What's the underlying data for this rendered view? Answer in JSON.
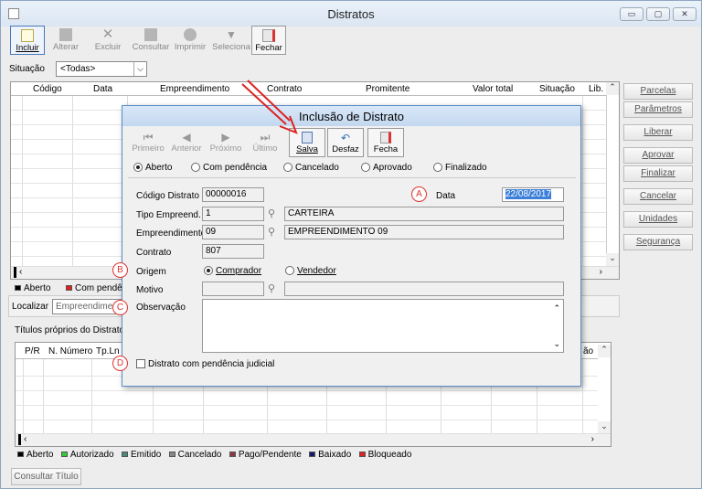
{
  "window": {
    "title": "Distratos",
    "min": "▭",
    "max": "▢",
    "close": "✕"
  },
  "toolbar": {
    "incluir": "Incluir",
    "alterar": "Alterar",
    "excluir": "Excluir",
    "consultar": "Consultar",
    "imprimir": "Imprimir",
    "selecionar": "Seleciona",
    "fechar": "Fechar"
  },
  "filter": {
    "label": "Situação",
    "value": "<Todas>"
  },
  "grid": {
    "columns": [
      "Código",
      "Data",
      "Empreendimento",
      "Contrato",
      "Promitente",
      "Valor total",
      "Situação",
      "Lib."
    ]
  },
  "side_buttons": [
    "Parcelas",
    "Parâmetros",
    "Liberar",
    "Aprovar",
    "Finalizar",
    "Cancelar",
    "Unidades",
    "Segurança"
  ],
  "legend1": [
    {
      "label": "Aberto",
      "color": "#000000"
    },
    {
      "label": "Com pendên",
      "color": "#e02020"
    }
  ],
  "localizar": {
    "label": "Localizar",
    "value": "Empreendimen"
  },
  "titulos": {
    "label": "Títulos próprios do Distrato",
    "columns": [
      "P/R",
      "N. Número",
      "Tp.Ln",
      "ão"
    ]
  },
  "legend2": [
    {
      "label": "Aberto",
      "color": "#000000"
    },
    {
      "label": "Autorizado",
      "color": "#33cc33"
    },
    {
      "label": "Emitido",
      "color": "#4a8a7a"
    },
    {
      "label": "Cancelado",
      "color": "#888888"
    },
    {
      "label": "Pago/Pendente",
      "color": "#8a3a4a"
    },
    {
      "label": "Baixado",
      "color": "#1a1a6a"
    },
    {
      "label": "Bloqueado",
      "color": "#dd2222"
    }
  ],
  "consultar_titulo": "Consultar Título",
  "dialog": {
    "title": "Inclusão de Distrato",
    "toolbar": {
      "primeiro": "Primeiro",
      "anterior": "Anterior",
      "proximo": "Próximo",
      "ultimo": "Último",
      "salva": "Salva",
      "desfaz": "Desfaz",
      "fecha": "Fecha"
    },
    "status_options": [
      "Aberto",
      "Com pendência",
      "Cancelado",
      "Aprovado",
      "Finalizado"
    ],
    "selected_status": "Aberto",
    "codigo_label": "Código Distrato",
    "codigo": "00000016",
    "data_label": "Data",
    "data": "22/08/2017",
    "tipo_label": "Tipo Empreend.",
    "tipo_code": "1",
    "tipo_name": "CARTEIRA",
    "emp_label": "Empreendimento",
    "emp_code": "09",
    "emp_name": "EMPREENDIMENTO 09",
    "contrato_label": "Contrato",
    "contrato": "807",
    "origem_label": "Origem",
    "origem_options": [
      "Comprador",
      "Vendedor"
    ],
    "motivo_label": "Motivo",
    "motivo": "",
    "obs_label": "Observação",
    "judicial_label": "Distrato com pendência judicial"
  },
  "callouts": [
    "A",
    "B",
    "C",
    "D"
  ]
}
